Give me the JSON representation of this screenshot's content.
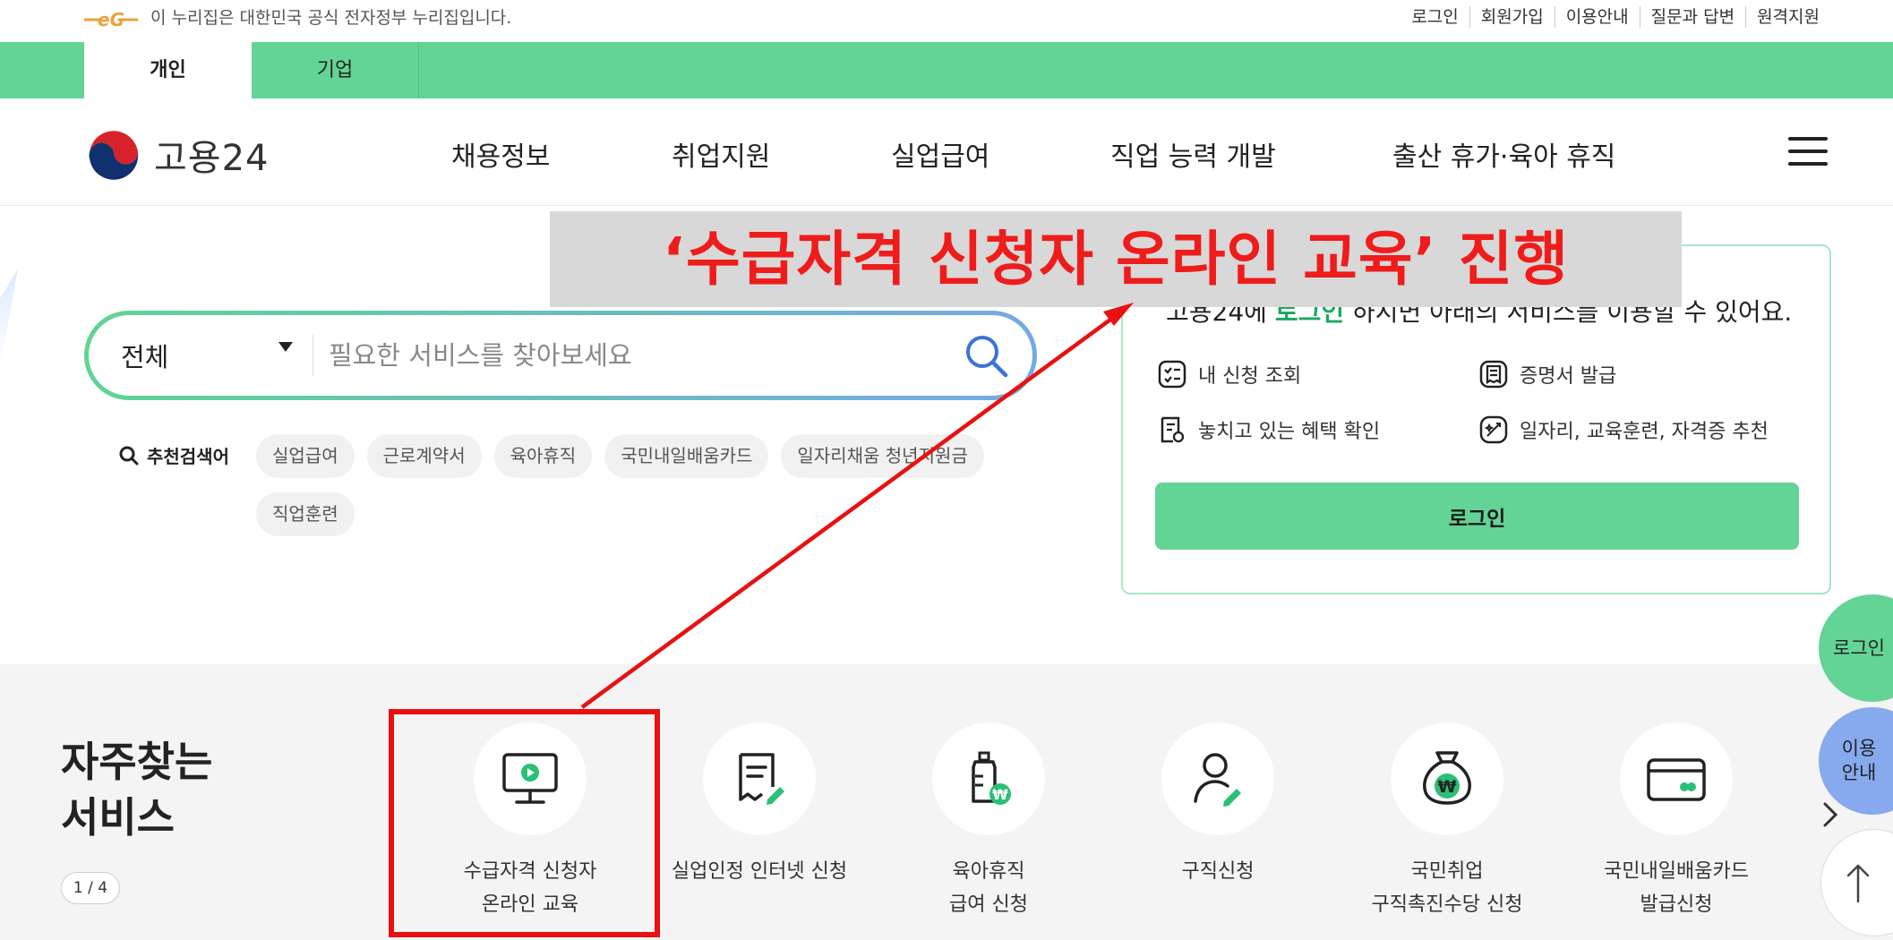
{
  "util_bar": {
    "gov_notice": "이 누리집은 대한민국 공식 전자정부 누리집입니다.",
    "links": [
      "로그인",
      "회원가입",
      "이용안내",
      "질문과 답변",
      "원격지원"
    ]
  },
  "tabs": [
    {
      "label": "개인",
      "active": true
    },
    {
      "label": "기업",
      "active": false
    }
  ],
  "header": {
    "logo_text": "고용24",
    "nav": [
      "채용정보",
      "취업지원",
      "실업급여",
      "직업 능력 개발",
      "출산 휴가·육아 휴직"
    ]
  },
  "search": {
    "scope": "전체",
    "placeholder": "필요한 서비스를 찾아보세요",
    "recommended_label": "추천검색어",
    "recommended": [
      "실업급여",
      "근로계약서",
      "육아휴직",
      "국민내일배움카드",
      "일자리채움 청년지원금",
      "직업훈련"
    ]
  },
  "login_box": {
    "title_prefix": "고용24에 ",
    "title_highlight": "로그인",
    "title_suffix": " 하시면 아래의 서비스를 이용할 수 있어요.",
    "services": [
      "내 신청 조회",
      "증명서 발급",
      "놓치고 있는 혜택 확인",
      "일자리, 교육훈련, 자격증 추천"
    ],
    "button": "로그인"
  },
  "frequent": {
    "title_line1": "자주찾는",
    "title_line2": "서비스",
    "pager": "1 / 4",
    "items": [
      {
        "label": "수급자격 신청자\n온라인 교육",
        "icon": "monitor-play-icon"
      },
      {
        "label": "실업인정 인터넷 신청",
        "icon": "document-pen-icon"
      },
      {
        "label": "육아휴직\n급여 신청",
        "icon": "baby-bottle-won-icon"
      },
      {
        "label": "구직신청",
        "icon": "person-pen-icon"
      },
      {
        "label": "국민취업\n구직촉진수당 신청",
        "icon": "money-bag-won-icon"
      },
      {
        "label": "국민내일배움카드\n발급신청",
        "icon": "card-icon"
      }
    ]
  },
  "floating": {
    "login": "로그인",
    "guide_line1": "이용",
    "guide_line2": "안내"
  },
  "annotation": {
    "text": "‘수급자격 신청자 온라인 교육’ 진행"
  },
  "colors": {
    "brand_green": "#63d495",
    "highlight_green": "#1aa85f",
    "guide_blue": "#87a9ee",
    "annotation_red": "#e81111"
  }
}
